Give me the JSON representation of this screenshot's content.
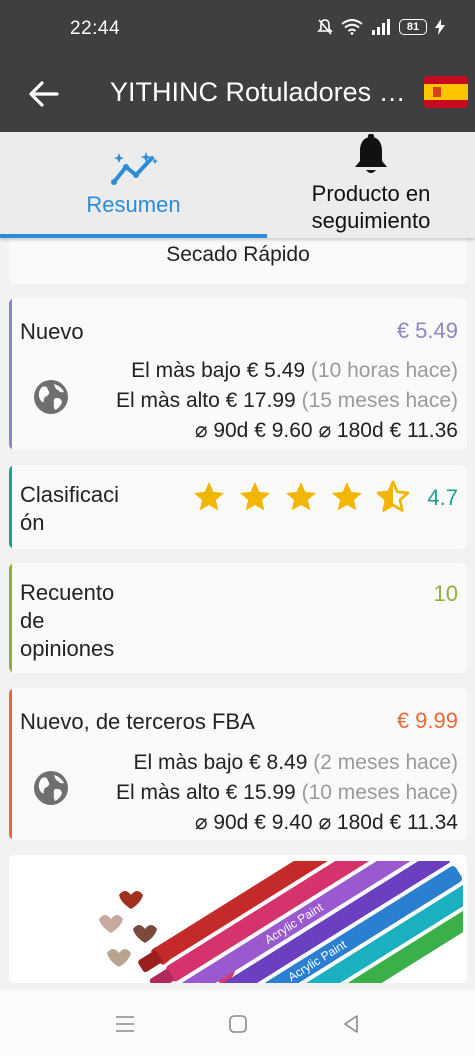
{
  "status": {
    "time": "22:44",
    "battery": "81"
  },
  "app_bar": {
    "title": "YITHINC Rotuladores d…"
  },
  "tabs": {
    "summary_label": "Resumen",
    "tracked_label": "Producto en seguimiento"
  },
  "top_card": {
    "text": "Secado Rápido"
  },
  "new": {
    "label": "Nuevo",
    "price": "€ 5.49",
    "lowest_label": "El màs bajo",
    "lowest_value": "€ 5.49",
    "lowest_when": "(10 horas hace)",
    "highest_label": "El màs alto",
    "highest_value": "€ 17.99",
    "highest_when": "(15 meses hace)",
    "avg90_label": "⌀ 90d",
    "avg90_value": "€ 9.60",
    "avg180_label": "⌀ 180d",
    "avg180_value": "€ 11.36",
    "color": "#8a87c9"
  },
  "rating": {
    "label": "Clasificaci ón",
    "value": "4.7",
    "stars": 4.5,
    "color": "#1aa38c"
  },
  "reviews": {
    "label": "Recuento de opiniones",
    "value": "10",
    "color": "#8fb13a"
  },
  "fba": {
    "label": "Nuevo, de terceros FBA",
    "price": "€ 9.99",
    "lowest_label": "El màs bajo",
    "lowest_value": "€ 8.49",
    "lowest_when": "(2 meses hace)",
    "highest_label": "El màs alto",
    "highest_value": "€ 15.99",
    "highest_when": "(10 meses hace)",
    "avg90_label": "⌀ 90d",
    "avg90_value": "€ 9.40",
    "avg180_label": "⌀ 180d",
    "avg180_value": "€ 11.34",
    "color": "#ea6a35"
  },
  "product_image": {
    "marker_text": "Acrylic Paint"
  },
  "icons": {
    "back": "arrow-left-icon",
    "flag": "spain-flag-icon",
    "summary": "trend-sparkle-icon",
    "tracked": "bell-icon",
    "globe": "globe-icon",
    "star": "star-icon"
  }
}
